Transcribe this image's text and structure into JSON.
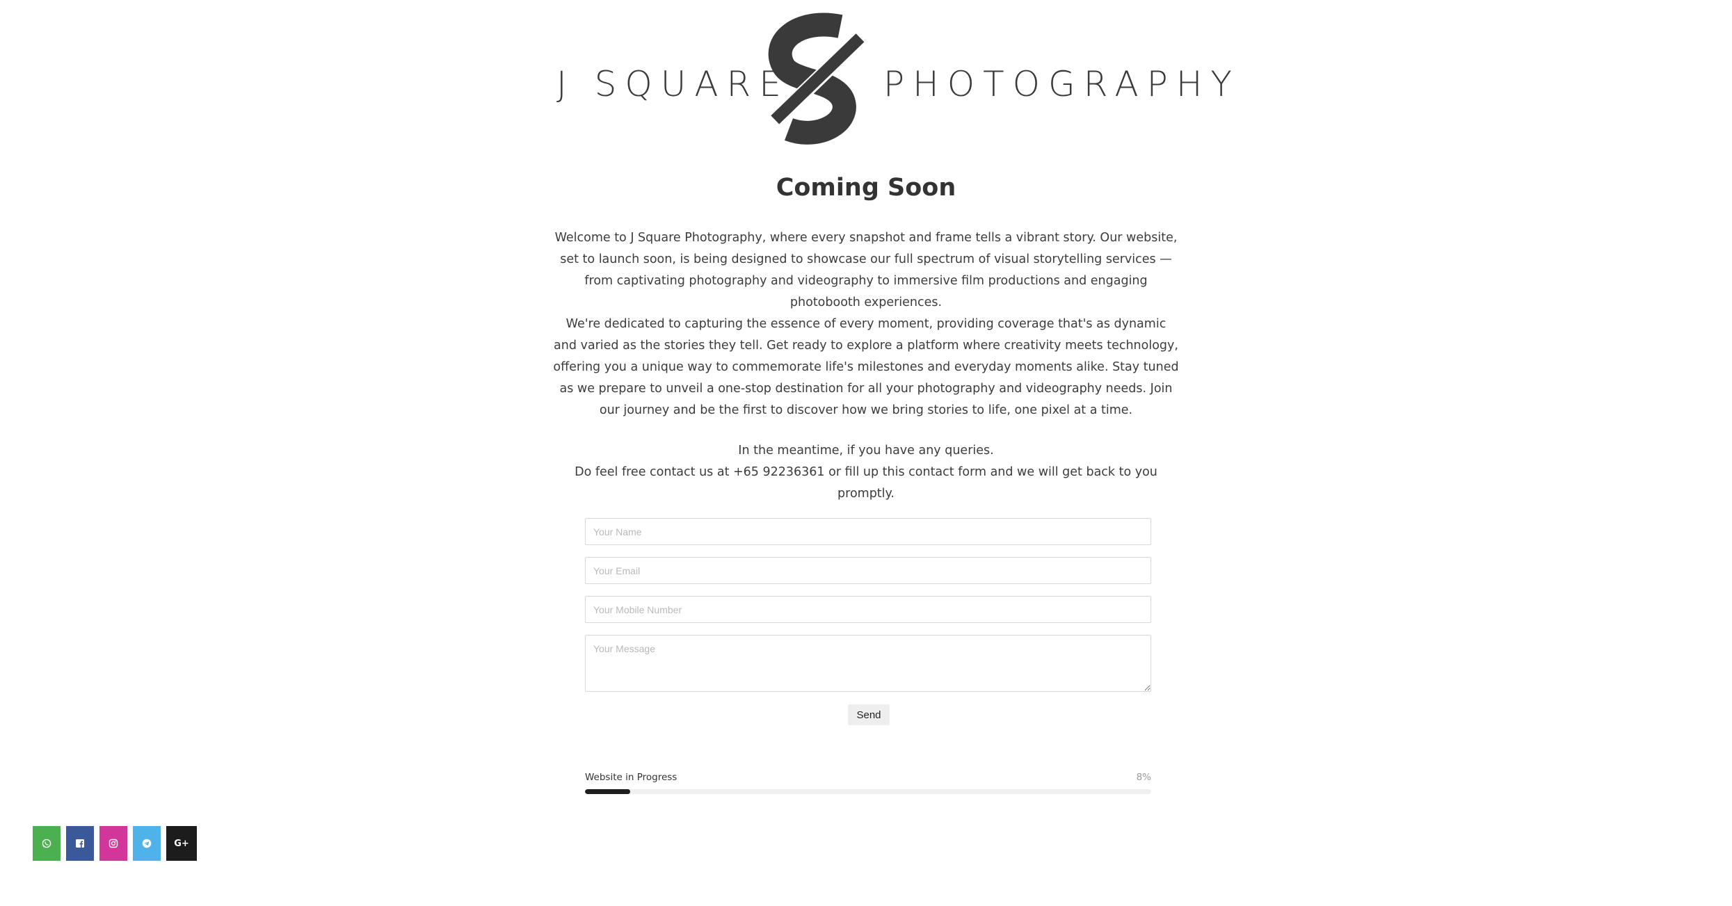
{
  "brand": {
    "name_left": "J SQUARE",
    "name_right": "PHOTOGRAPHY",
    "logo_icon": "s-monogram-icon"
  },
  "page": {
    "heading": "Coming Soon",
    "intro": "Welcome to J Square Photography, where every snapshot and frame tells a vibrant story. Our website, set to launch soon, is being designed to showcase our full spectrum of visual storytelling services — from captivating photography and videography to immersive film productions and engaging photobooth experiences.",
    "mission": "We're dedicated to capturing the essence of every moment, providing coverage that's as dynamic and varied as the stories they tell. Get ready to explore a platform where creativity meets technology, offering you a unique way to commemorate life's milestones and everyday moments alike. Stay tuned as we prepare to unveil a one-stop destination for all your photography and videography needs. Join our journey and be the first to discover how we bring stories to life, one pixel at a time.",
    "contact_line1": "In the meantime, if you have any queries.",
    "contact_line2": "Do feel free contact us at +65 92236361 or fill up this contact form and we will get back to you promptly."
  },
  "form": {
    "name_placeholder": "Your Name",
    "name_value": "",
    "email_placeholder": "Your Email",
    "email_value": "",
    "mobile_placeholder": "Your Mobile Number",
    "mobile_value": "",
    "message_placeholder": "Your Message",
    "message_value": "",
    "send_label": "Send"
  },
  "progress": {
    "label": "Website in Progress",
    "value_text": "8%",
    "percent": 8
  },
  "social": [
    {
      "icon": "whatsapp-icon",
      "color": "#4caf50"
    },
    {
      "icon": "facebook-icon",
      "color": "#3b5998"
    },
    {
      "icon": "instagram-icon",
      "color": "#d2369b"
    },
    {
      "icon": "telegram-icon",
      "color": "#4fb3ea"
    },
    {
      "icon": "google-plus-icon",
      "color": "#1c1c1c",
      "text": "G+"
    }
  ],
  "colors": {
    "text": "#333333",
    "field_border": "#d7d7d7",
    "button_bg": "#eeeeee",
    "progress_fill": "#1e1e1e",
    "progress_track": "#f0f0f0"
  }
}
